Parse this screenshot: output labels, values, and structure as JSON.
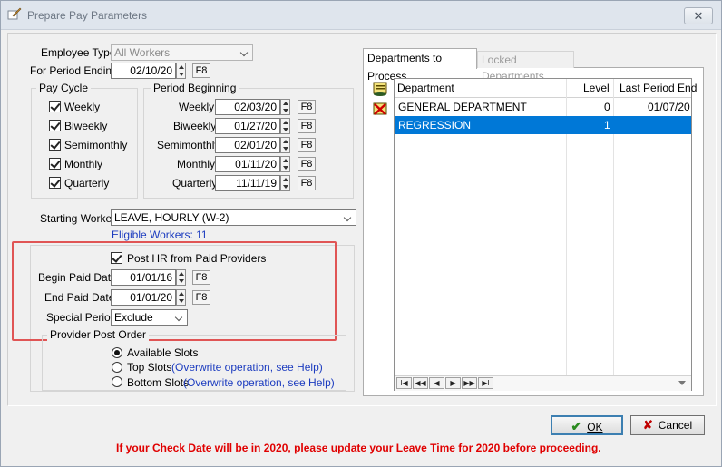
{
  "window": {
    "title": "Prepare Pay Parameters",
    "close_glyph": "✕"
  },
  "params": {
    "employee_type_label": "Employee Type",
    "employee_type_value": "All Workers",
    "period_ending_label": "For Period Ending",
    "period_ending_value": "02/10/20",
    "f8": "F8"
  },
  "pay_cycle": {
    "title": "Pay Cycle",
    "items": [
      "Weekly",
      "Biweekly",
      "Semimonthly",
      "Monthly",
      "Quarterly"
    ]
  },
  "period_beginning": {
    "title": "Period Beginning",
    "rows": [
      {
        "label": "Weekly",
        "value": "02/03/20"
      },
      {
        "label": "Biweekly",
        "value": "01/27/20"
      },
      {
        "label": "Semimonthly",
        "value": "02/01/20"
      },
      {
        "label": "Monthly",
        "value": "01/11/20"
      },
      {
        "label": "Quarterly",
        "value": "11/11/19"
      }
    ]
  },
  "starting_worker": {
    "label": "Starting Worker",
    "value": "LEAVE, HOURLY (W-2)",
    "eligible": "Eligible Workers: 11"
  },
  "paid_providers": {
    "post_hr_label": "Post HR from Paid Providers",
    "begin_label": "Begin Paid Date",
    "begin_value": "01/01/16",
    "end_label": "End Paid Date",
    "end_value": "01/01/20",
    "special_label": "Special Period",
    "special_value": "Exclude"
  },
  "provider_post_order": {
    "title": "Provider Post Order",
    "options": [
      {
        "label": "Available Slots",
        "note": ""
      },
      {
        "label": "Top Slots",
        "note": "(Overwrite operation, see Help)"
      },
      {
        "label": "Bottom Slots",
        "note": "(Overwrite operation, see Help)"
      }
    ]
  },
  "tabs": [
    "Departments to Process",
    "Locked Departments"
  ],
  "departments": {
    "columns": [
      "Department",
      "Level",
      "Last Period End"
    ],
    "rows": [
      {
        "name": "GENERAL DEPARTMENT",
        "level": "0",
        "last": "01/07/20"
      },
      {
        "name": "REGRESSION",
        "level": "1",
        "last": ""
      }
    ],
    "nav": [
      "I◀",
      "◀◀",
      "◀",
      "▶",
      "▶▶",
      "▶I"
    ]
  },
  "buttons": {
    "ok": "OK",
    "cancel": "Cancel"
  },
  "warning": "If your Check Date will be in 2020, please update your Leave Time for 2020 before proceeding.",
  "colors": {
    "selection": "#0078d7",
    "warning": "#e00000",
    "link_blue": "#1b3bbf",
    "highlight_box": "#e05555"
  }
}
